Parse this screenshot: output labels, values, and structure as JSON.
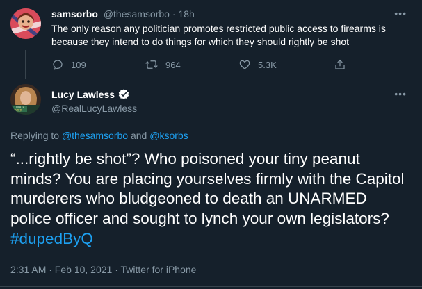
{
  "reply_tweet": {
    "display_name": "samsorbo",
    "handle": "@thesamsorbo",
    "separator": "·",
    "time": "18h",
    "text": "The only reason any politician promotes restricted public access to firearms is because they intend to do things for which they should rightly be shot",
    "stats": {
      "replies": "109",
      "retweets": "964",
      "likes": "5.3K"
    }
  },
  "main_tweet": {
    "display_name": "Lucy Lawless",
    "handle": "@RealLucyLawless",
    "replying_prefix": "Replying to",
    "replying_user1": "@thesamsorbo",
    "replying_and": "and",
    "replying_user2": "@ksorbs",
    "text_main": "“...rightly be shot”? Who poisoned your tiny peanut minds? You are placing yourselves firmly with the Capitol murderers who bludgeoned to death an UNARMED police officer and sought to lynch your own legislators?",
    "hashtag": "#dupedByQ",
    "timestamp": "2:31 AM · Feb 10, 2021 · Twitter for iPhone"
  },
  "colors": {
    "background": "#15202b",
    "muted": "#8899a6",
    "link": "#1da1f2",
    "border": "#38444d"
  }
}
